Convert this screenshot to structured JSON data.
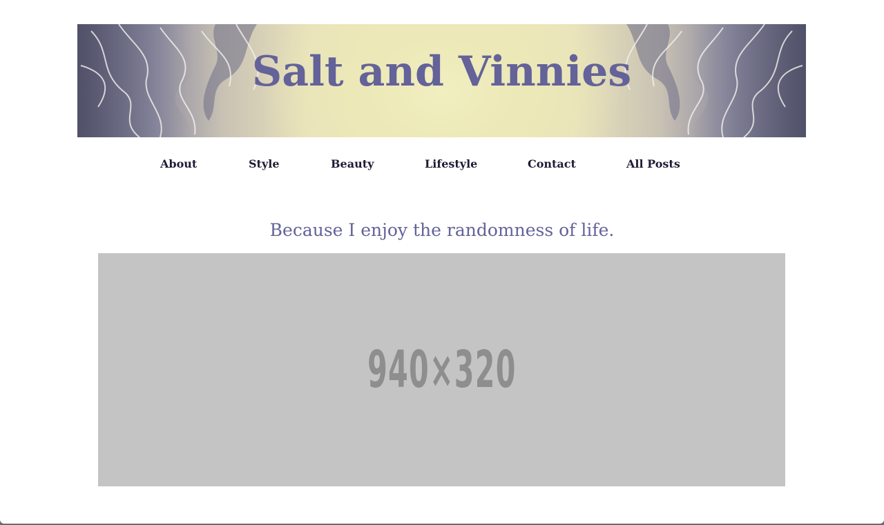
{
  "header": {
    "site_title": "Salt and Vinnies"
  },
  "nav": {
    "items": [
      {
        "label": "About"
      },
      {
        "label": "Style"
      },
      {
        "label": "Beauty"
      },
      {
        "label": "Lifestyle"
      },
      {
        "label": "Contact"
      },
      {
        "label": "All Posts"
      }
    ]
  },
  "main": {
    "tagline": "Because I enjoy the randomness of life.",
    "image_placeholder_label": "940×320"
  },
  "colors": {
    "title_accent": "#636299",
    "nav_text": "#1e1c34",
    "placeholder_bg": "#c4c4c4",
    "placeholder_text": "#8e8e8e"
  }
}
